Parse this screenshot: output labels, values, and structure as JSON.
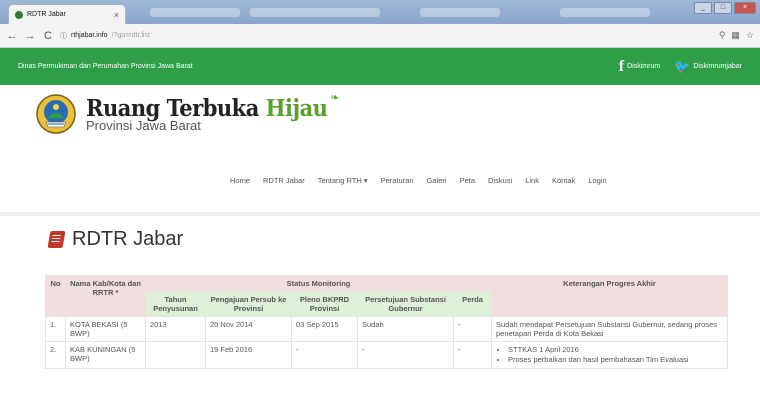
{
  "browser": {
    "tab_title": "RDTR Jabar",
    "url_host": "rthjabar.info",
    "url_path": "/?go=rdtr.list"
  },
  "topbar": {
    "org_name": "Dinas Permukiman dan Perumahan Provinsi Jawa Barat",
    "facebook_label": "Diskimrum",
    "twitter_label": "Diskimrumjabar"
  },
  "brand": {
    "title_part1": "Ruang Terbuka ",
    "title_part2": "Hijau",
    "subtitle": "Provinsi Jawa Barat"
  },
  "nav": {
    "items": [
      "Home",
      "RDTR Jabar",
      "Tentang RTH",
      "Peraturan",
      "Galeri",
      "Peta",
      "Diskusi",
      "Link",
      "Kontak",
      "Login"
    ]
  },
  "page": {
    "title": "RDTR Jabar"
  },
  "table": {
    "headers": {
      "no": "No",
      "nama": "Nama Kab/Kota dan RRTR *",
      "status": "Status Monitoring",
      "tahun": "Tahun Penyusunan",
      "pengajuan": "Pengajuan Persub ke Provinsi",
      "pleno": "Pleno BKPRD Provinsi",
      "persetujuan": "Persetujuan Substansi Gubernur",
      "perda": "Perda",
      "keterangan": "Keterangan Progres Akhir"
    },
    "rows": [
      {
        "no": "1.",
        "nama": "KOTA BEKASI (5 BWP)",
        "tahun": "2013",
        "pengajuan": "20 Nov 2014",
        "pleno": "03 Sep 2015",
        "persetujuan": "Sudah",
        "perda": "-",
        "keterangan": "Sudah mendapat Persetujuan Substansi Gubernur, sedang proses penetapan Perda di Kota Bekasi"
      },
      {
        "no": "2.",
        "nama": "KAB KUNINGAN (5 BWP)",
        "tahun": "",
        "pengajuan": "19 Feb 2016",
        "pleno": "-",
        "persetujuan": "-",
        "perda": "-",
        "keterangan_items": [
          "STTKAS 1 April 2016",
          "Proses perbaikan dan hasil pembahasan Tim Evaluasi"
        ]
      }
    ]
  },
  "colors": {
    "topbar_green": "#2e9e49",
    "accent_green": "#5aa02c",
    "header_red_bg": "#f2dede",
    "header_green_bg": "#dff0d8",
    "title_icon_red": "#c0392b"
  },
  "icons": {
    "facebook": "facebook-icon",
    "twitter": "twitter-icon",
    "page_title": "book-icon",
    "emblem": "province-emblem-icon"
  }
}
